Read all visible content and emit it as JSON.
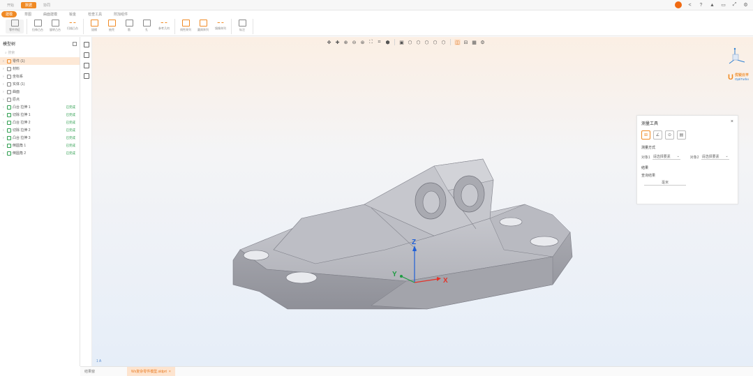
{
  "app_tabs": [
    "开始",
    "数据",
    "协同"
  ],
  "menu_tabs": [
    "建模",
    "草图",
    "曲面建模",
    "钣金",
    "检查工具",
    "附加组件"
  ],
  "ribbon": {
    "groups": [
      {
        "items": [
          "零件特征"
        ]
      },
      {
        "items": [
          "拉伸凸台",
          "旋转凸台",
          "扫描凸台"
        ]
      },
      {
        "items": [
          "拔模",
          "抽壳",
          "筋",
          "孔",
          "参考几何"
        ]
      },
      {
        "items": [
          "线性阵列",
          "圆周阵列",
          "镜像阵列"
        ]
      },
      {
        "items": [
          "标注"
        ]
      }
    ]
  },
  "tree": {
    "title": "模型树",
    "search_placeholder": "搜索",
    "items": [
      {
        "label": "零件 (1)",
        "tag": "",
        "selected": true
      },
      {
        "label": "材料",
        "tag": ""
      },
      {
        "label": "坐标系",
        "tag": ""
      },
      {
        "label": "实体 (1)",
        "tag": ""
      },
      {
        "label": "曲面",
        "tag": ""
      },
      {
        "label": "原点",
        "tag": ""
      },
      {
        "label": "凸台 拉伸 1",
        "tag": "已完成"
      },
      {
        "label": "切除 拉伸 1",
        "tag": "已完成"
      },
      {
        "label": "凸台 拉伸 2",
        "tag": "已完成"
      },
      {
        "label": "切除 拉伸 2",
        "tag": "已完成"
      },
      {
        "label": "凸台 拉伸 3",
        "tag": "已完成"
      },
      {
        "label": "倒圆角 1",
        "tag": "已完成"
      },
      {
        "label": "倒圆角 2",
        "tag": "已完成"
      }
    ]
  },
  "measure": {
    "title": "测量工具",
    "close": "×",
    "section_label": "测量方式",
    "option1_label": "对象1",
    "option1_value": "请选择要素",
    "option2_label": "对象2",
    "option2_value": "请选择要素",
    "result_label": "结果",
    "result_value": "查询结果",
    "unit": "毫米"
  },
  "brand": {
    "name": "优锐云平",
    "sub": "OptiTurbo"
  },
  "axes": {
    "x": "X",
    "y": "Y",
    "z": "Z"
  },
  "scale_text": "1 A",
  "status": {
    "left_tab": "结果窗",
    "file_tab": "Wx复杂零件模型.sldprt",
    "file_close": "×"
  },
  "colors": {
    "accent": "#f08a24",
    "brand_blue": "#2d7fd3",
    "model_gray": "#b8b9c0",
    "ok_green": "#2e9e4f"
  }
}
